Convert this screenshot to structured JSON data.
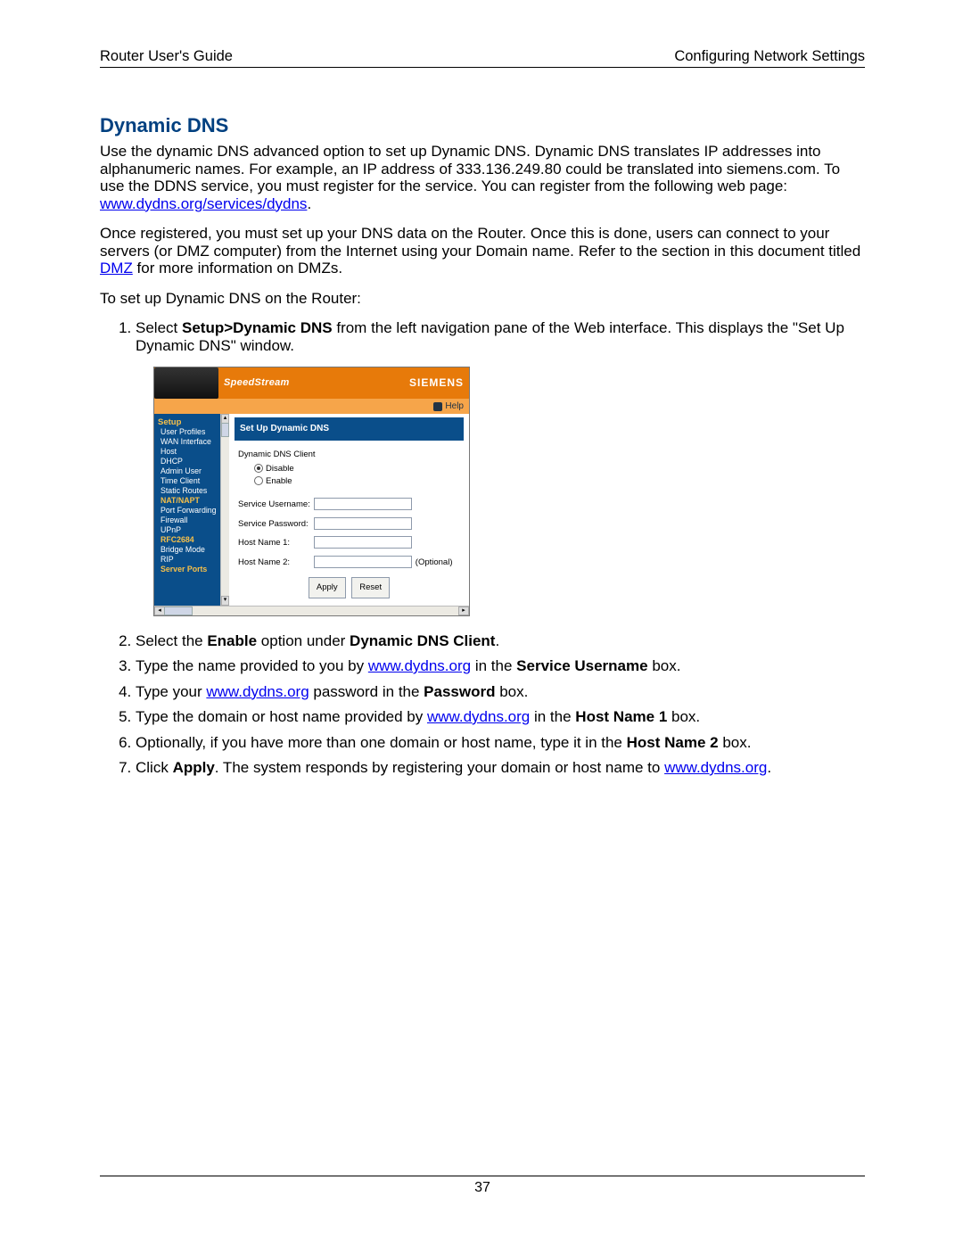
{
  "header": {
    "left": "Router User's Guide",
    "right": "Configuring Network Settings"
  },
  "title": "Dynamic DNS",
  "para1_a": "Use the dynamic DNS advanced option to set up Dynamic DNS. Dynamic DNS translates IP addresses into alphanumeric names. For example, an IP address of 333.136.249.80 could be translated into siemens.com. To use the DDNS service, you must register for the service. You can register from the following web page: ",
  "para1_link": "www.dydns.org/services/dydns",
  "para1_b": ".",
  "para2_a": "Once registered, you must set up your DNS data on the Router. Once this is done, users can connect to your servers (or DMZ computer) from the Internet using your Domain name. Refer to the section in this document titled ",
  "para2_link": "DMZ",
  "para2_b": " for more information on DMZs.",
  "para3": "To set up Dynamic DNS on the Router:",
  "step1_a": "Select ",
  "step1_bold": "Setup>Dynamic DNS",
  "step1_b": " from the left navigation pane of the Web interface. This displays the \"Set Up Dynamic DNS\" window.",
  "step2_a": "Select the ",
  "step2_bold1": "Enable",
  "step2_b": " option under ",
  "step2_bold2": "Dynamic DNS Client",
  "step2_c": ".",
  "step3_a": "Type the name provided to you by ",
  "step3_link": "www.dydns.org",
  "step3_b": " in the ",
  "step3_bold": "Service Username",
  "step3_c": " box.",
  "step4_a": "Type your ",
  "step4_link": "www.dydns.org",
  "step4_b": " password in the ",
  "step4_bold": "Password",
  "step4_c": " box.",
  "step5_a": "Type the domain or host name provided by ",
  "step5_link": "www.dydns.org",
  "step5_b": " in the ",
  "step5_bold": "Host Name 1",
  "step5_c": " box.",
  "step6_a": "Optionally, if you have more than one domain or host name, type it in the ",
  "step6_bold": "Host Name 2",
  "step6_b": " box.",
  "step7_a": "Click ",
  "step7_bold": "Apply",
  "step7_b": ". The system responds by registering your domain or host name to ",
  "step7_link": "www.dydns.org",
  "step7_c": ".",
  "page_number": "37",
  "shot": {
    "brand": "SpeedStream",
    "siemens": "SIEMENS",
    "help": "Help",
    "nav_header": "Setup",
    "nav_items": [
      "User Profiles",
      "WAN Interface",
      "Host",
      "DHCP",
      "Admin User",
      "Time Client",
      "Static Routes",
      "NAT/NAPT",
      "Port Forwarding",
      "Firewall",
      "UPnP",
      "RFC2684",
      "Bridge Mode",
      "RIP",
      "Server Ports"
    ],
    "pane_title": "Set Up Dynamic DNS",
    "group_label": "Dynamic DNS Client",
    "radio_disable": "Disable",
    "radio_enable": "Enable",
    "field_user": "Service Username:",
    "field_pass": "Service Password:",
    "field_h1": "Host Name 1:",
    "field_h2": "Host Name 2:",
    "optional": "(Optional)",
    "btn_apply": "Apply",
    "btn_reset": "Reset"
  }
}
